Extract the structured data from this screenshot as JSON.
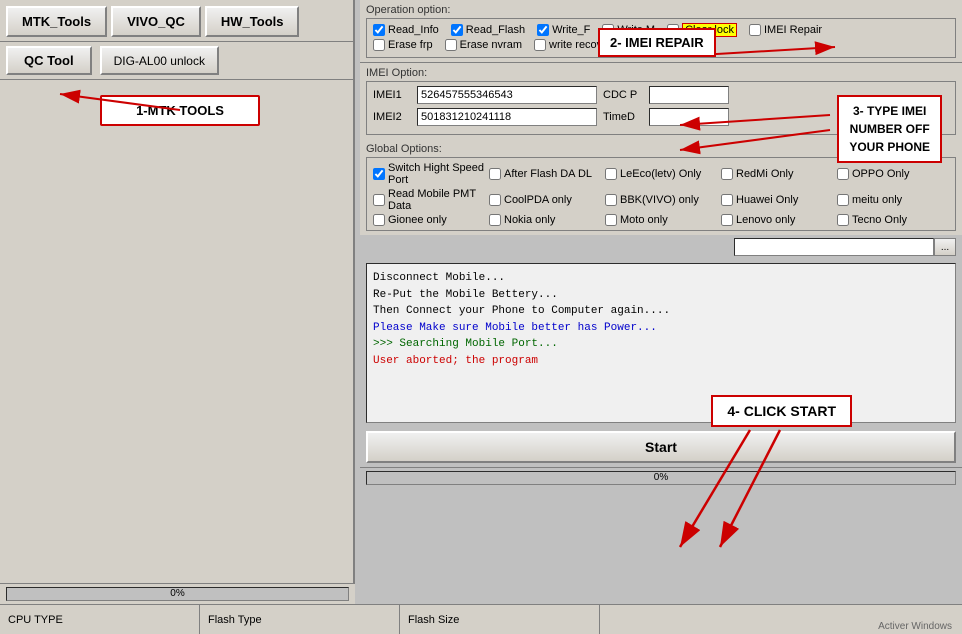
{
  "toolbar": {
    "mtk_tools": "MTK_Tools",
    "vivo_qc": "VIVO_QC",
    "hw_tools": "HW_Tools",
    "qc_tool": "QC Tool",
    "dig_al00": "DIG-AL00 unlock"
  },
  "annotations": {
    "label1": "1-MTK TOOLS",
    "label2": "2- IMEI REPAIR",
    "label3": "3- TYPE IMEI\nNUMBER OFF\nYOUR PHONE",
    "label4": "4- CLICK START"
  },
  "operation_options": {
    "label": "Operation option:",
    "checkboxes_row1": [
      {
        "id": "read_info",
        "label": "Read_Info",
        "checked": true
      },
      {
        "id": "read_flash",
        "label": "Read_Flash",
        "checked": true
      },
      {
        "id": "write_f",
        "label": "Write_F",
        "checked": true
      },
      {
        "id": "write_m",
        "label": "Write M",
        "checked": false
      },
      {
        "id": "clear_lock",
        "label": "Clear lock",
        "checked": false
      },
      {
        "id": "imei_repair",
        "label": "IMEI Repair",
        "checked": false
      }
    ],
    "checkboxes_row2": [
      {
        "id": "erase_frp",
        "label": "Erase frp",
        "checked": false
      },
      {
        "id": "erase_nvram",
        "label": "Erase nvram",
        "checked": false
      },
      {
        "id": "write_recovery",
        "label": "write recovery",
        "checked": false
      }
    ]
  },
  "imei_options": {
    "label": "IMEI Option:",
    "imei1_label": "IMEI1",
    "imei1_value": "526457555346543",
    "imei2_label": "IMEI2",
    "imei2_value": "501831210241118",
    "cdc_label": "CDC P",
    "time_label": "TimeD"
  },
  "global_options": {
    "label": "Global Options:",
    "checkboxes": [
      {
        "id": "switch_hight",
        "label": "Switch Hight Speed Port",
        "checked": true
      },
      {
        "id": "after_flash",
        "label": "After Flash DA DL",
        "checked": false
      },
      {
        "id": "leeco",
        "label": "LeEco(letv) Only",
        "checked": false
      },
      {
        "id": "redmi",
        "label": "RedMi Only",
        "checked": false
      },
      {
        "id": "oppo",
        "label": "OPPO Only",
        "checked": false
      },
      {
        "id": "read_mobile",
        "label": "Read Mobile PMT Data",
        "checked": false
      },
      {
        "id": "coolpda",
        "label": "CoolPDA only",
        "checked": false
      },
      {
        "id": "bbk_vivo",
        "label": "BBK(VIVO) only",
        "checked": false
      },
      {
        "id": "huawei",
        "label": "Huawei Only",
        "checked": false
      },
      {
        "id": "meitu",
        "label": "meitu only",
        "checked": false
      },
      {
        "id": "gionee",
        "label": "Gionee only",
        "checked": false
      },
      {
        "id": "nokia",
        "label": "Nokia only",
        "checked": false
      },
      {
        "id": "moto",
        "label": "Moto only",
        "checked": false
      },
      {
        "id": "lenovo",
        "label": "Lenovo only",
        "checked": false
      },
      {
        "id": "tecno",
        "label": "Tecno Only",
        "checked": false
      }
    ]
  },
  "console": {
    "lines": [
      {
        "text": "Disconnect Mobile...",
        "color": "black"
      },
      {
        "text": "Re-Put the Mobile Bettery...",
        "color": "black"
      },
      {
        "text": "Then Connect your Phone to Computer again....",
        "color": "black"
      },
      {
        "text": "Please Make sure Mobile better has Power...",
        "color": "blue"
      },
      {
        "text": ">>> Searching Mobile Port...",
        "color": "green"
      },
      {
        "text": "User aborted; the program",
        "color": "red"
      }
    ]
  },
  "buttons": {
    "start": "Start",
    "search_btn": "..."
  },
  "progress": {
    "left_percent": "0%",
    "right_percent": "0%"
  },
  "bottom_bar": {
    "cpu_type": "CPU TYPE",
    "flash_type": "Flash Type",
    "flash_size": "Flash Size"
  },
  "activate_windows": "Activer Windows"
}
